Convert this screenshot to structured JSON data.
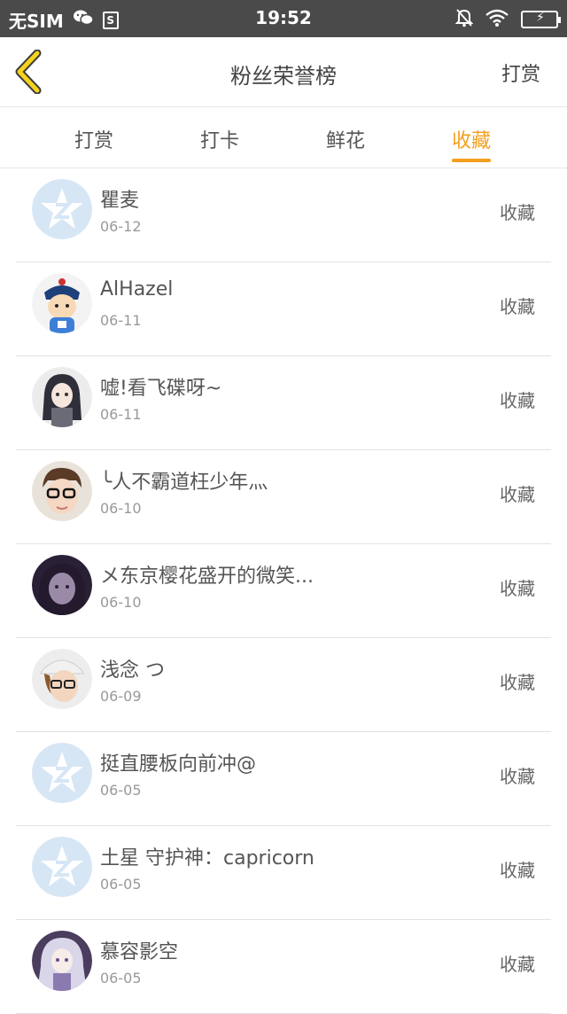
{
  "status_bar": {
    "carrier": "无SIM",
    "time": "19:52",
    "icons": [
      "wechat-icon",
      "sim-icon",
      "mute-icon",
      "wifi-icon",
      "battery-charging-icon"
    ]
  },
  "header": {
    "title": "粉丝荣誉榜",
    "action_label": "打赏"
  },
  "tabs": [
    {
      "label": "打赏"
    },
    {
      "label": "打卡"
    },
    {
      "label": "鲜花"
    },
    {
      "label": "收藏",
      "active": true
    }
  ],
  "colors": {
    "accent": "#f4a01e",
    "status_bar": "#4a4a4a",
    "divider": "#e2e2e2"
  },
  "rows": [
    {
      "name": "瞿麦",
      "date": "06-12",
      "action": "收藏",
      "avatar": "default-star-avatar"
    },
    {
      "name": "AlHazel",
      "date": "06-11",
      "action": "收藏",
      "avatar": "cartoon-avatar"
    },
    {
      "name": "嘘!看飞碟呀~",
      "date": "06-11",
      "action": "收藏",
      "avatar": "anime-avatar"
    },
    {
      "name": "╰人不霸道枉少年灬",
      "date": "06-10",
      "action": "收藏",
      "avatar": "glasses-avatar"
    },
    {
      "name": "メ东京樱花盛开的微笑...",
      "date": "06-10",
      "action": "收藏",
      "avatar": "dark-portrait-avatar"
    },
    {
      "name": "浅念 つ",
      "date": "06-09",
      "action": "收藏",
      "avatar": "hat-portrait-avatar"
    },
    {
      "name": "挺直腰板向前冲@",
      "date": "06-05",
      "action": "收藏",
      "avatar": "default-star-avatar"
    },
    {
      "name": "土星 守护神：capricorn",
      "date": "06-05",
      "action": "收藏",
      "avatar": "default-star-avatar"
    },
    {
      "name": "慕容影空",
      "date": "06-05",
      "action": "收藏",
      "avatar": "anime-girl-avatar"
    }
  ]
}
